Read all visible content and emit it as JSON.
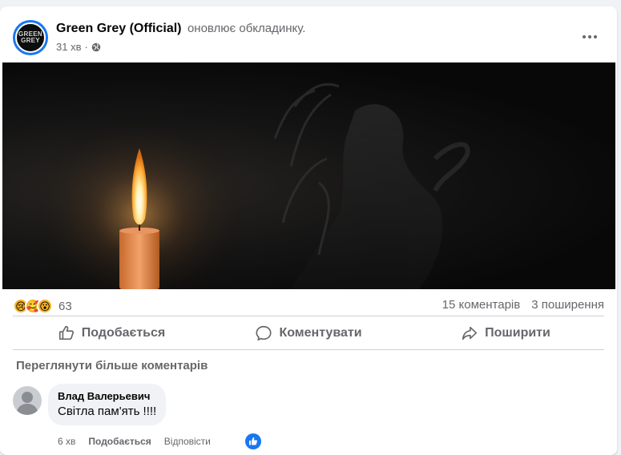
{
  "post": {
    "author": "Green Grey (Official)",
    "action": "оновлює обкладинку.",
    "time": "31 хв",
    "separator": "·",
    "avatar_text": "GREEN GREY"
  },
  "stats": {
    "reactions_count": "63",
    "comments": "15 коментарів",
    "shares": "3 поширення",
    "reaction_icons": [
      "crying-face-icon",
      "care-face-icon",
      "wow-face-icon"
    ]
  },
  "actions": {
    "like": "Подобається",
    "comment": "Коментувати",
    "share": "Поширити"
  },
  "comments": {
    "view_more": "Переглянути більше коментарів",
    "items": [
      {
        "author": "Влад Валерьевич",
        "text": "Світла пам'ять !!!!",
        "time": "6 хв",
        "like_label": "Подобається",
        "reply_label": "Відповісти"
      }
    ]
  },
  "colors": {
    "accent": "#1877f2",
    "text_secondary": "#65676b",
    "background": "#f0f2f5"
  }
}
